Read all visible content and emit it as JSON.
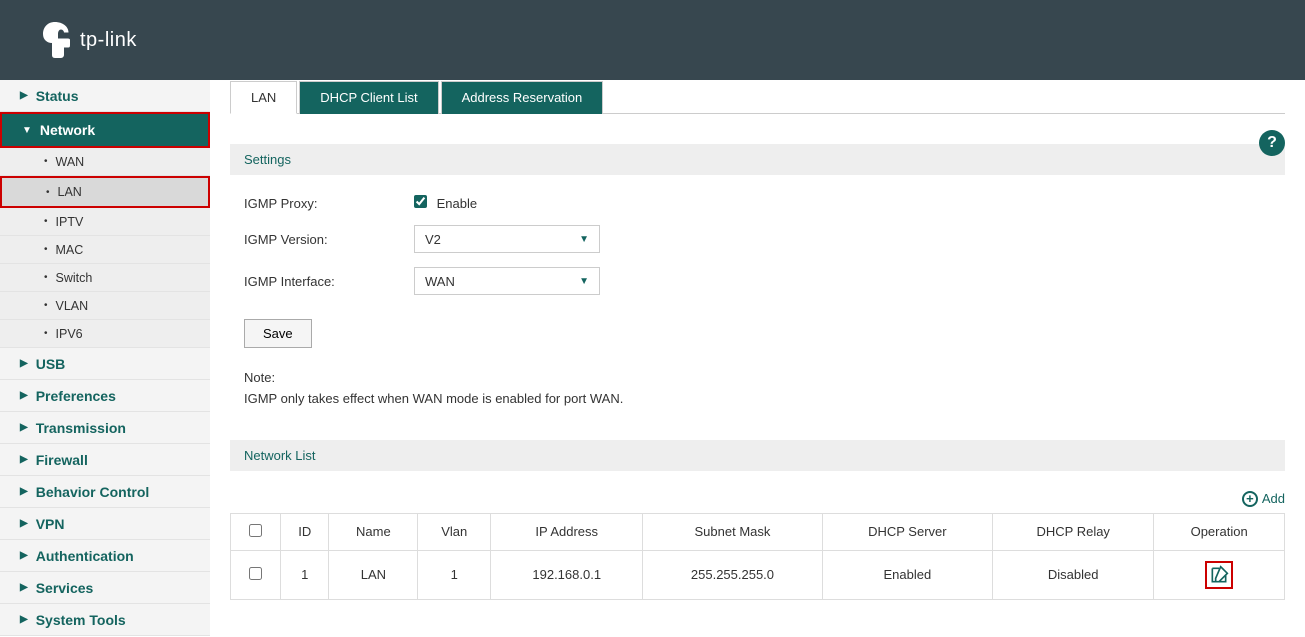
{
  "brand": "tp-link",
  "sidebar": {
    "items": [
      {
        "label": "Status",
        "type": "item"
      },
      {
        "label": "Network",
        "type": "item-active"
      },
      {
        "label": "WAN",
        "type": "sub"
      },
      {
        "label": "LAN",
        "type": "sub-active"
      },
      {
        "label": "IPTV",
        "type": "sub"
      },
      {
        "label": "MAC",
        "type": "sub"
      },
      {
        "label": "Switch",
        "type": "sub"
      },
      {
        "label": "VLAN",
        "type": "sub"
      },
      {
        "label": "IPV6",
        "type": "sub"
      },
      {
        "label": "USB",
        "type": "item"
      },
      {
        "label": "Preferences",
        "type": "item"
      },
      {
        "label": "Transmission",
        "type": "item"
      },
      {
        "label": "Firewall",
        "type": "item"
      },
      {
        "label": "Behavior Control",
        "type": "item"
      },
      {
        "label": "VPN",
        "type": "item"
      },
      {
        "label": "Authentication",
        "type": "item"
      },
      {
        "label": "Services",
        "type": "item"
      },
      {
        "label": "System Tools",
        "type": "item"
      }
    ]
  },
  "tabs": [
    "LAN",
    "DHCP Client List",
    "Address Reservation"
  ],
  "sections": {
    "settings": "Settings",
    "network_list": "Network List"
  },
  "form": {
    "igmp_proxy_label": "IGMP Proxy:",
    "igmp_proxy_enable": "Enable",
    "igmp_version_label": "IGMP Version:",
    "igmp_version_value": "V2",
    "igmp_interface_label": "IGMP Interface:",
    "igmp_interface_value": "WAN",
    "save": "Save",
    "note_label": "Note:",
    "note_text": "IGMP only takes effect when WAN mode is enabled for port WAN."
  },
  "add_label": "Add",
  "table": {
    "headers": [
      "ID",
      "Name",
      "Vlan",
      "IP Address",
      "Subnet Mask",
      "DHCP Server",
      "DHCP Relay",
      "Operation"
    ],
    "rows": [
      {
        "id": "1",
        "name": "LAN",
        "vlan": "1",
        "ip": "192.168.0.1",
        "mask": "255.255.255.0",
        "dhcp_server": "Enabled",
        "dhcp_relay": "Disabled"
      }
    ]
  }
}
